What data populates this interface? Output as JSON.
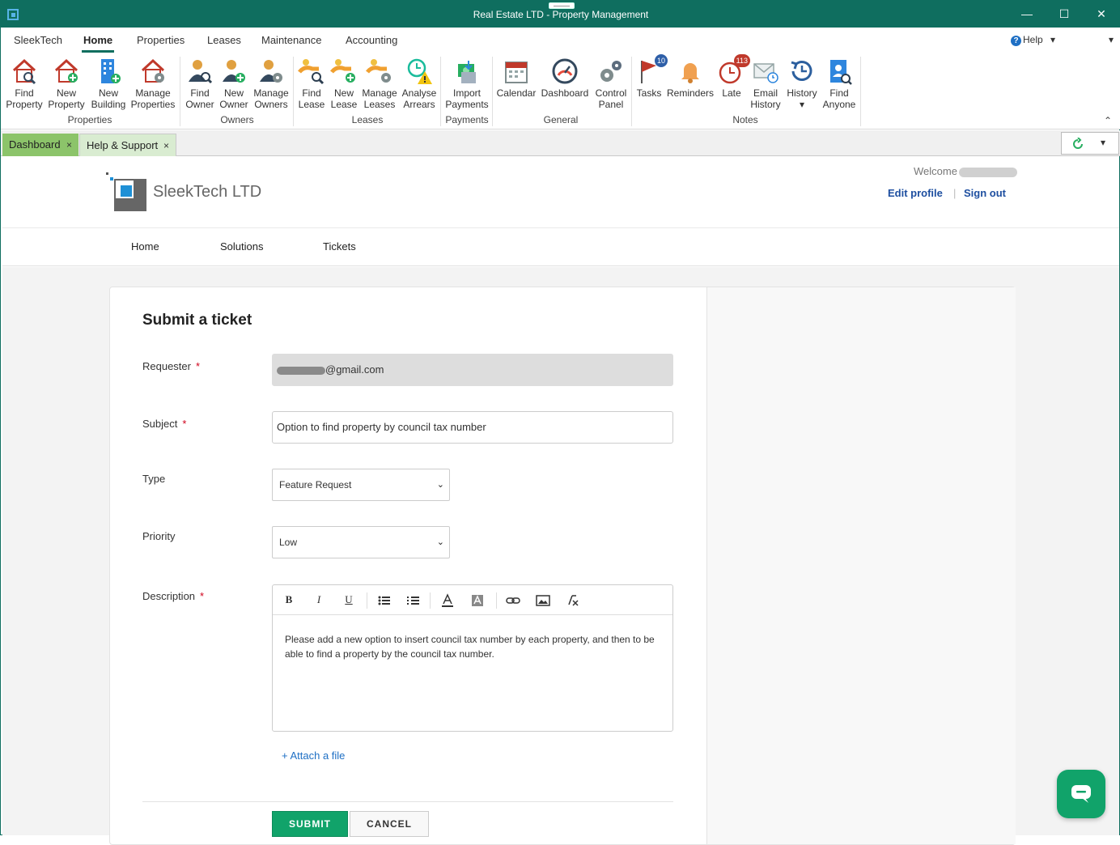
{
  "window": {
    "title": "Real Estate LTD - Property Management",
    "minimize_glyph": "—",
    "maximize_glyph": "☐",
    "close_glyph": "✕"
  },
  "ribbon_tabs": [
    "SleekTech",
    "Home",
    "Properties",
    "Leases",
    "Maintenance",
    "Accounting"
  ],
  "ribbon_right": {
    "help": "Help",
    "help_dropdown": "▾",
    "user_dropdown": "▾"
  },
  "ribbon": {
    "buttons": [
      {
        "line1": "Find",
        "line2": "Property",
        "icon": "house-search-icon"
      },
      {
        "line1": "New",
        "line2": "Property",
        "icon": "house-add-icon"
      },
      {
        "line1": "New",
        "line2": "Building",
        "icon": "building-add-icon"
      },
      {
        "line1": "Manage",
        "line2": "Properties",
        "icon": "house-gear-icon"
      },
      {
        "line1": "Find",
        "line2": "Owner",
        "icon": "person-search-icon"
      },
      {
        "line1": "New",
        "line2": "Owner",
        "icon": "person-add-icon"
      },
      {
        "line1": "Manage",
        "line2": "Owners",
        "icon": "person-gear-icon"
      },
      {
        "line1": "Find",
        "line2": "Lease",
        "icon": "hand-key-search-icon"
      },
      {
        "line1": "New",
        "line2": "Lease",
        "icon": "hand-key-add-icon"
      },
      {
        "line1": "Manage",
        "line2": "Leases",
        "icon": "hand-key-gear-icon"
      },
      {
        "line1": "Analyse",
        "line2": "Arrears",
        "icon": "clock-warning-icon"
      },
      {
        "line1": "Import",
        "line2": "Payments",
        "icon": "money-import-icon"
      },
      {
        "line1": "Calendar",
        "line2": "",
        "icon": "calendar-icon"
      },
      {
        "line1": "Dashboard",
        "line2": "",
        "icon": "gauge-icon"
      },
      {
        "line1": "Control",
        "line2": "Panel",
        "icon": "gears-icon"
      },
      {
        "line1": "Tasks",
        "line2": "",
        "icon": "flag-icon",
        "badge": "10"
      },
      {
        "line1": "Reminders",
        "line2": "",
        "icon": "bell-icon"
      },
      {
        "line1": "Late",
        "line2": "",
        "icon": "clock-late-icon",
        "badge": "113"
      },
      {
        "line1": "Email",
        "line2": "History",
        "icon": "envelope-clock-icon"
      },
      {
        "line1": "History",
        "line2": "▾",
        "icon": "history-icon"
      },
      {
        "line1": "Find",
        "line2": "Anyone",
        "icon": "contact-search-icon"
      }
    ],
    "groups": [
      "Properties",
      "Owners",
      "Leases",
      "Payments",
      "General",
      "Notes"
    ],
    "collapse_glyph": "⌃"
  },
  "doc_tabs": [
    {
      "label": "Dashboard",
      "close": "×"
    },
    {
      "label": "Help & Support",
      "close": "×"
    }
  ],
  "doc_tabs_right": {
    "dropdown": "▾"
  },
  "portal": {
    "logo_text": "SleekTech LTD",
    "welcome": "Welcome",
    "edit_profile": "Edit profile",
    "separator": "|",
    "sign_out": "Sign out",
    "nav": [
      "Home",
      "Solutions",
      "Tickets"
    ]
  },
  "form": {
    "title": "Submit a ticket",
    "required_mark": "*",
    "requester_label": "Requester",
    "requester_value": "@gmail.com",
    "subject_label": "Subject",
    "subject_value": "Option to find property by council tax number",
    "type_label": "Type",
    "type_value": "Feature Request",
    "priority_label": "Priority",
    "priority_value": "Low",
    "description_label": "Description",
    "description_value": "Please add a new option to insert council tax number by each property, and then to be able to find a property by the council tax number.",
    "attach": "+ Attach a file",
    "submit": "SUBMIT",
    "cancel": "CANCEL",
    "select_chevron": "⌄"
  },
  "editor_toolbar": {
    "bold": "B",
    "italic": "I",
    "underline": "U"
  },
  "colors": {
    "titlebar": "#0f6e5f",
    "accent_green": "#11a36a",
    "link_blue": "#1e4fa0",
    "required_red": "#d0021b",
    "dashboard_tab": "#8cc46a",
    "help_tab": "#d9ecd1"
  }
}
